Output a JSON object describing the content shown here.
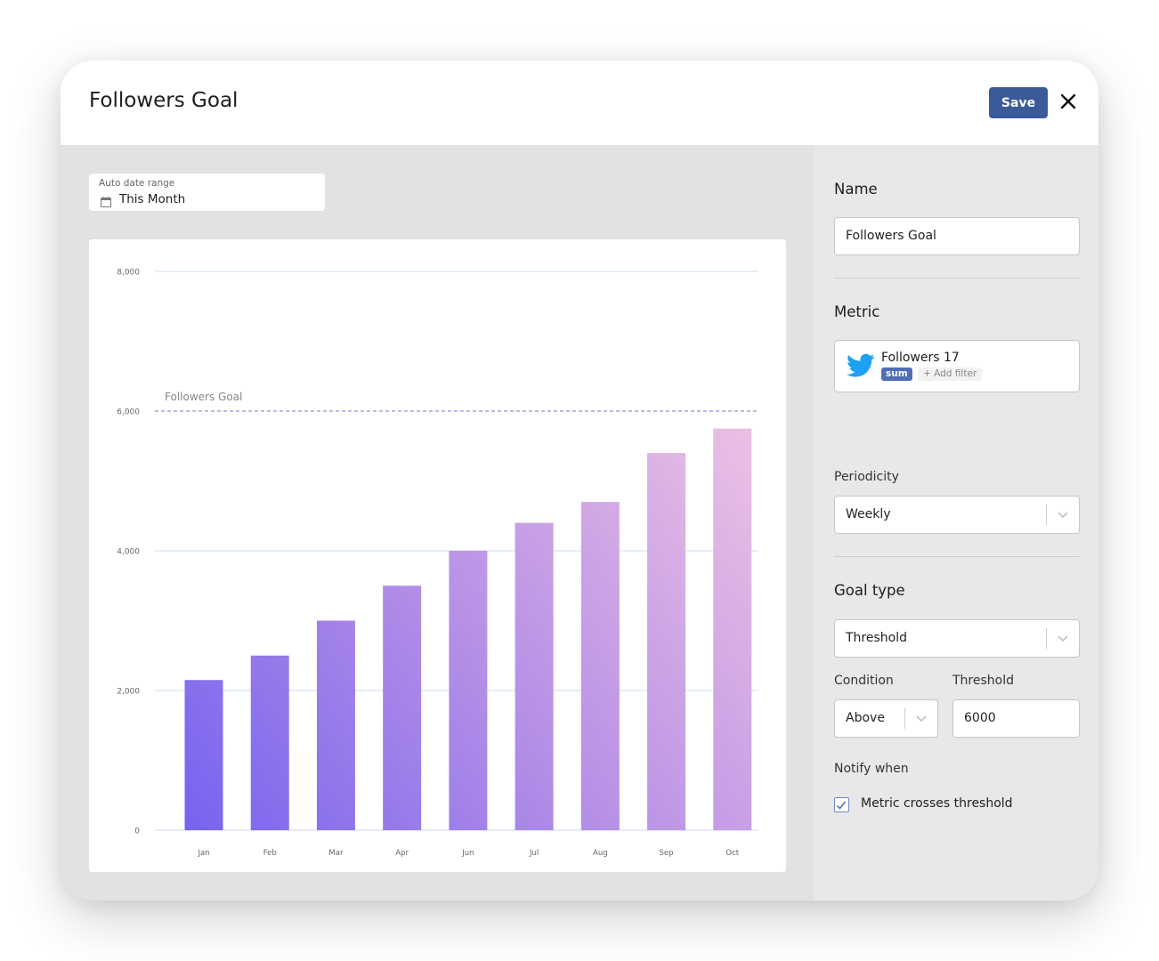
{
  "header": {
    "title": "Followers Goal",
    "save_label": "Save",
    "close_icon": "close-icon"
  },
  "date_range": {
    "label": "Auto date range",
    "value": "This Month",
    "icon": "calendar-icon"
  },
  "colors": {
    "save_button": "#3b5a9a",
    "bar_gradient_start": "#7461ef",
    "bar_gradient_end": "#ebbfe4",
    "goal_line": "#8f97c7",
    "gridline": "#dde7f7",
    "twitter_blue": "#1da1f2",
    "sum_badge": "#4e6eb6"
  },
  "chart_data": {
    "type": "bar",
    "title": "",
    "xlabel": "",
    "ylabel": "",
    "categories": [
      "Jan",
      "Feb",
      "Mar",
      "Apr",
      "Jun",
      "Jul",
      "Aug",
      "Sep",
      "Oct"
    ],
    "values": [
      2150,
      2500,
      3000,
      3500,
      4000,
      4400,
      4700,
      5400,
      5750
    ],
    "ylim": [
      0,
      8000
    ],
    "yticks": [
      0,
      2000,
      4000,
      6000,
      8000
    ],
    "ytick_labels": [
      "0",
      "2,000",
      "4,000",
      "6,000",
      "8,000"
    ],
    "grid": true,
    "goal_line": {
      "value": 6000,
      "label": "Followers Goal",
      "style": "dashed"
    }
  },
  "settings": {
    "name_label": "Name",
    "name_value": "Followers Goal",
    "metric_label": "Metric",
    "metric": {
      "icon": "twitter-icon",
      "name": "Followers 17",
      "aggregation": "sum",
      "add_filter": "+ Add filter"
    },
    "periodicity_label": "Periodicity",
    "periodicity_value": "Weekly",
    "goal_type_label": "Goal type",
    "goal_type_value": "Threshold",
    "condition_label": "Condition",
    "condition_value": "Above",
    "threshold_label": "Threshold",
    "threshold_value": "6000",
    "notify_label": "Notify when",
    "notify_option": "Metric crosses threshold",
    "notify_checked": true
  }
}
